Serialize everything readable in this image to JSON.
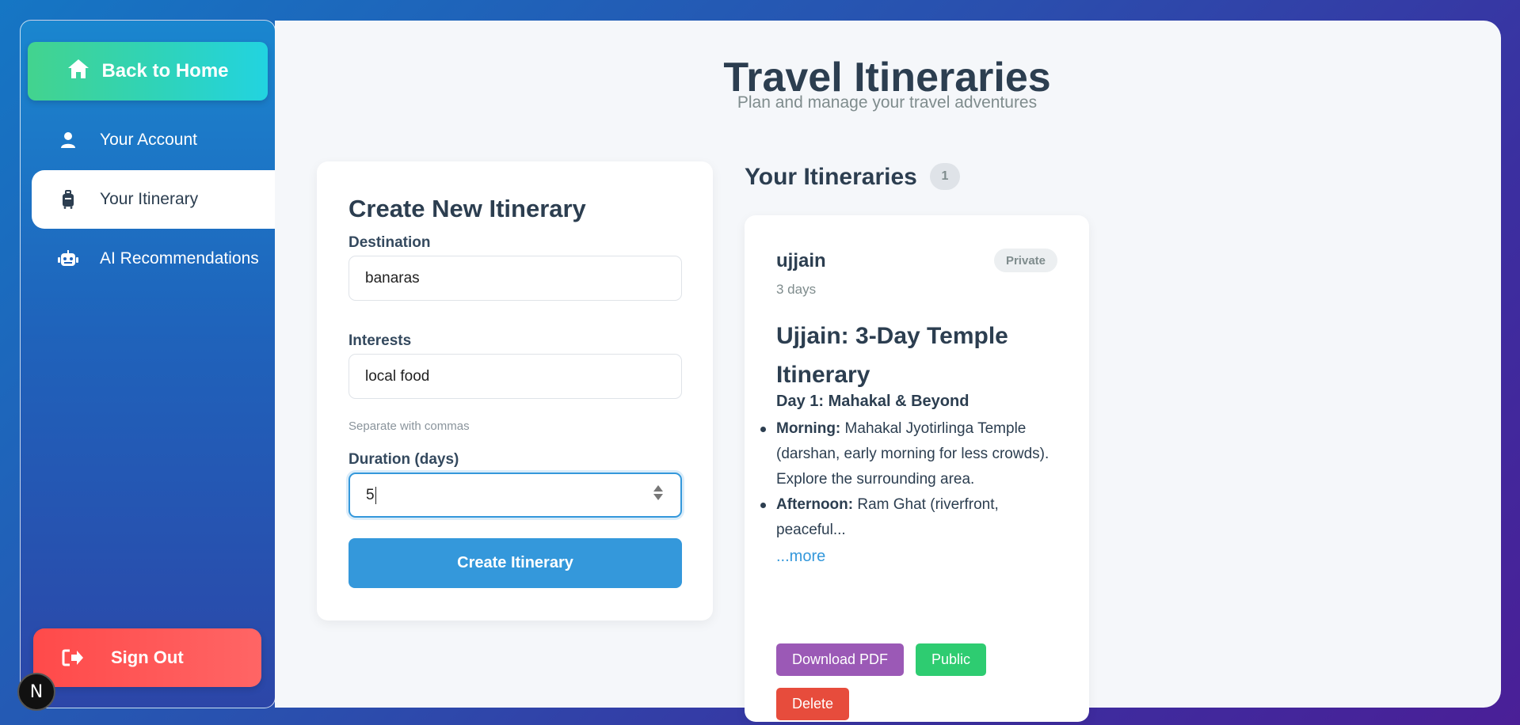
{
  "sidebar": {
    "home_label": "Back to Home",
    "items": [
      {
        "label": "Your Account",
        "icon": "user-icon"
      },
      {
        "label": "Your Itinerary",
        "icon": "suitcase-icon",
        "active": true
      },
      {
        "label": "AI Recommendations",
        "icon": "robot-icon"
      }
    ],
    "signout_label": "Sign Out",
    "badge_letter": "N"
  },
  "header": {
    "title": "Travel Itineraries",
    "subtitle": "Plan and manage your travel adventures"
  },
  "form": {
    "title": "Create New Itinerary",
    "destination_label": "Destination",
    "destination_value": "banaras",
    "interests_label": "Interests",
    "interests_value": "local food",
    "interests_hint": "Separate with commas",
    "duration_label": "Duration (days)",
    "duration_value": "5",
    "submit_label": "Create Itinerary"
  },
  "itineraries": {
    "title": "Your Itineraries",
    "count": "1",
    "items": [
      {
        "name": "ujjain",
        "visibility": "Private",
        "days": "3 days",
        "heading": "Ujjain: 3-Day Temple Itinerary",
        "day_title": "Day 1: Mahakal & Beyond",
        "bullets": [
          {
            "label": "Morning:",
            "text": "Mahakal Jyotirlinga Temple (darshan, early morning for less crowds). Explore the surrounding area."
          },
          {
            "label": "Afternoon:",
            "text": "Ram Ghat (riverfront, peaceful..."
          }
        ],
        "more_label": "...more",
        "actions": {
          "pdf": "Download PDF",
          "public": "Public",
          "delete": "Delete"
        }
      }
    ]
  },
  "colors": {
    "primary": "#3498db",
    "pdf": "#9b59b6",
    "public": "#2ecc71",
    "delete": "#e74c3c",
    "signout": "#ff5a5a"
  }
}
